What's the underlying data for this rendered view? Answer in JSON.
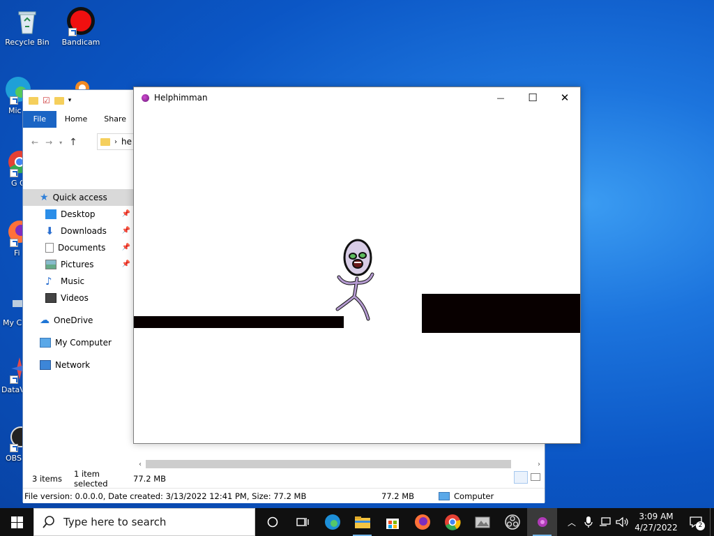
{
  "desktop": {
    "icons": [
      {
        "label": "Recycle Bin"
      },
      {
        "label": "Bandicam"
      },
      {
        "label": "Mic E"
      },
      {
        "label": "G Ch"
      },
      {
        "label": "Fi"
      },
      {
        "label": "My C"
      },
      {
        "label": "DataV"
      },
      {
        "label": "OBS"
      }
    ]
  },
  "explorer": {
    "ribbon_tabs": [
      "File",
      "Home",
      "Share"
    ],
    "address_text": "he",
    "sidebar": {
      "quick_access": "Quick access",
      "items": [
        {
          "label": "Desktop",
          "icon": "desktop-icon",
          "pinned": true
        },
        {
          "label": "Downloads",
          "icon": "download-arrow-icon",
          "pinned": true
        },
        {
          "label": "Documents",
          "icon": "document-icon",
          "pinned": true
        },
        {
          "label": "Pictures",
          "icon": "picture-icon",
          "pinned": true
        },
        {
          "label": "Music",
          "icon": "music-note-icon",
          "pinned": false
        },
        {
          "label": "Videos",
          "icon": "film-icon",
          "pinned": false
        }
      ],
      "onedrive": "OneDrive",
      "my_computer": "My Computer",
      "network": "Network"
    },
    "status": {
      "items": "3 items",
      "selected": "1 item selected",
      "size": "77.2 MB"
    },
    "details_bar": {
      "info": "File version: 0.0.0.0, Date created: 3/13/2022 12:41 PM, Size: 77.2 MB",
      "size": "77.2 MB",
      "location": "Computer"
    }
  },
  "game_window": {
    "title": "Helphimman",
    "controls": {
      "minimize": "—",
      "maximize": "☐",
      "close": "✕"
    }
  },
  "taskbar": {
    "search_placeholder": "Type here to search",
    "time": "3:09 AM",
    "date": "4/27/2022",
    "notification_count": "2"
  },
  "colors": {
    "platform": "#080000",
    "accent": "#1a64c4",
    "taskbar": "#101010"
  }
}
